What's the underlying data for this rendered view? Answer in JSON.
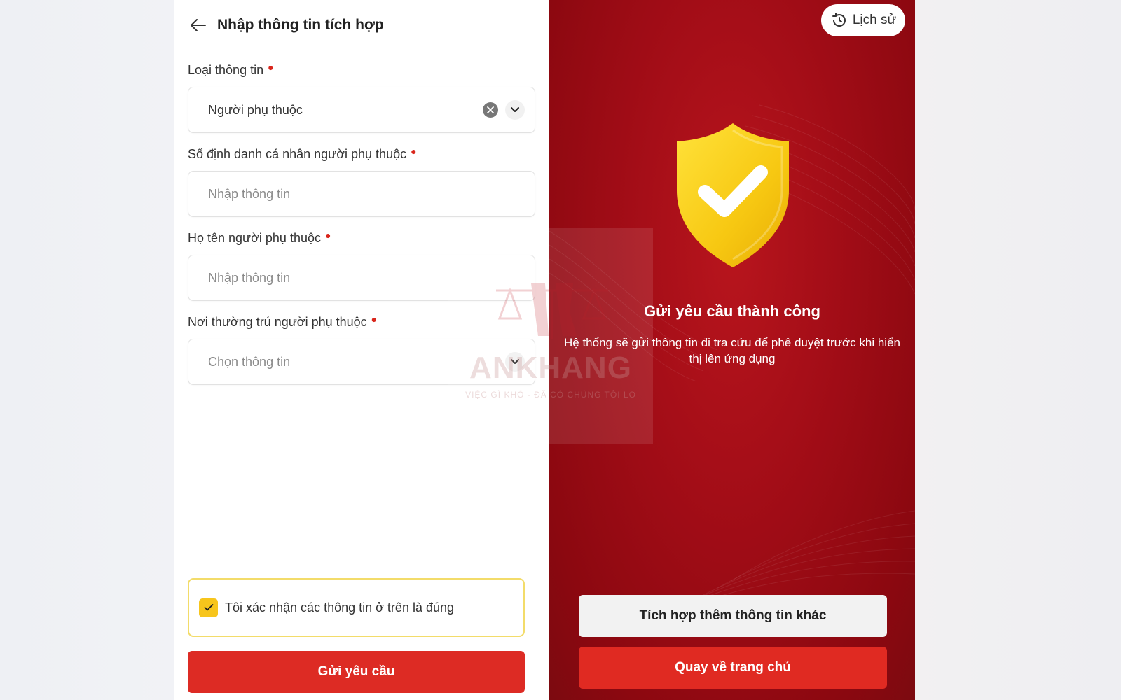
{
  "left_screen": {
    "header": {
      "title": "Nhập thông tin tích hợp",
      "back_icon": "arrow-left-icon"
    },
    "fields": [
      {
        "label": "Loại thông tin",
        "required": true,
        "value": "Người phụ thuộc",
        "type": "select"
      },
      {
        "label": "Số định danh cá nhân người phụ thuộc",
        "required": true,
        "placeholder": "Nhập thông tin",
        "type": "input"
      },
      {
        "label": "Họ tên người phụ thuộc",
        "required": true,
        "placeholder": "Nhập thông tin",
        "type": "input"
      },
      {
        "label": "Nơi thường trú người phụ thuộc",
        "required": true,
        "placeholder": "Chọn thông tin",
        "type": "select"
      }
    ],
    "confirm": {
      "text": "Tôi xác nhận các thông tin ở trên là đúng",
      "checked": true
    },
    "submit_label": "Gửi yêu cầu"
  },
  "right_screen": {
    "history_label": "Lịch sử",
    "success_title": "Gửi yêu cầu thành công",
    "success_desc": "Hệ thống sẽ gửi thông tin đi tra cứu để phê duyệt trước khi hiển thị lên ứng dụng",
    "more_button": "Tích hợp thêm thông tin khác",
    "home_button": "Quay về trang chủ"
  },
  "watermark": {
    "name": "ANKHANG",
    "tagline": "VIỆC GÌ KHÓ - ĐÃ CÓ CHÚNG TÔI LO"
  },
  "colors": {
    "primary_red": "#dd2b24",
    "panel_red": "#a30d17",
    "checkbox_yellow": "#f7c51c",
    "required_dot": "#d9261c"
  }
}
